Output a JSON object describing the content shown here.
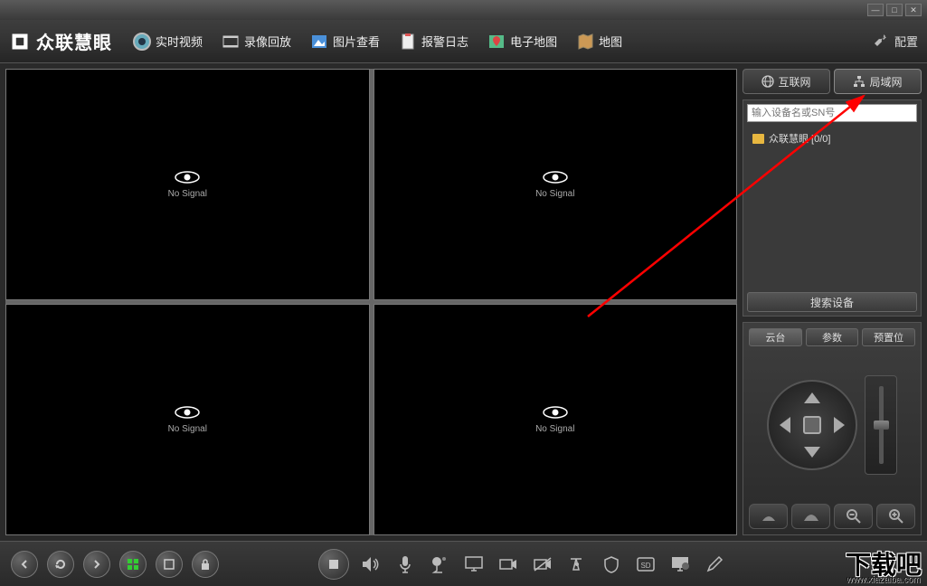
{
  "app": {
    "title": "众联慧眼"
  },
  "nav": {
    "live": "实时视频",
    "playback": "录像回放",
    "image": "图片查看",
    "alarm": "报警日志",
    "emap": "电子地图",
    "map": "地图",
    "config": "配置"
  },
  "video": {
    "no_signal": "No Signal"
  },
  "right": {
    "internet": "互联网",
    "lan": "局域网",
    "search_placeholder": "输入设备名或SN号",
    "root_node": "众联慧眼 [0/0]",
    "search_btn": "搜索设备"
  },
  "ptz": {
    "tab_ptz": "云台",
    "tab_param": "参数",
    "tab_preset": "预置位"
  },
  "watermark": {
    "text": "下载吧",
    "url": "www.xiazaiba.com"
  }
}
